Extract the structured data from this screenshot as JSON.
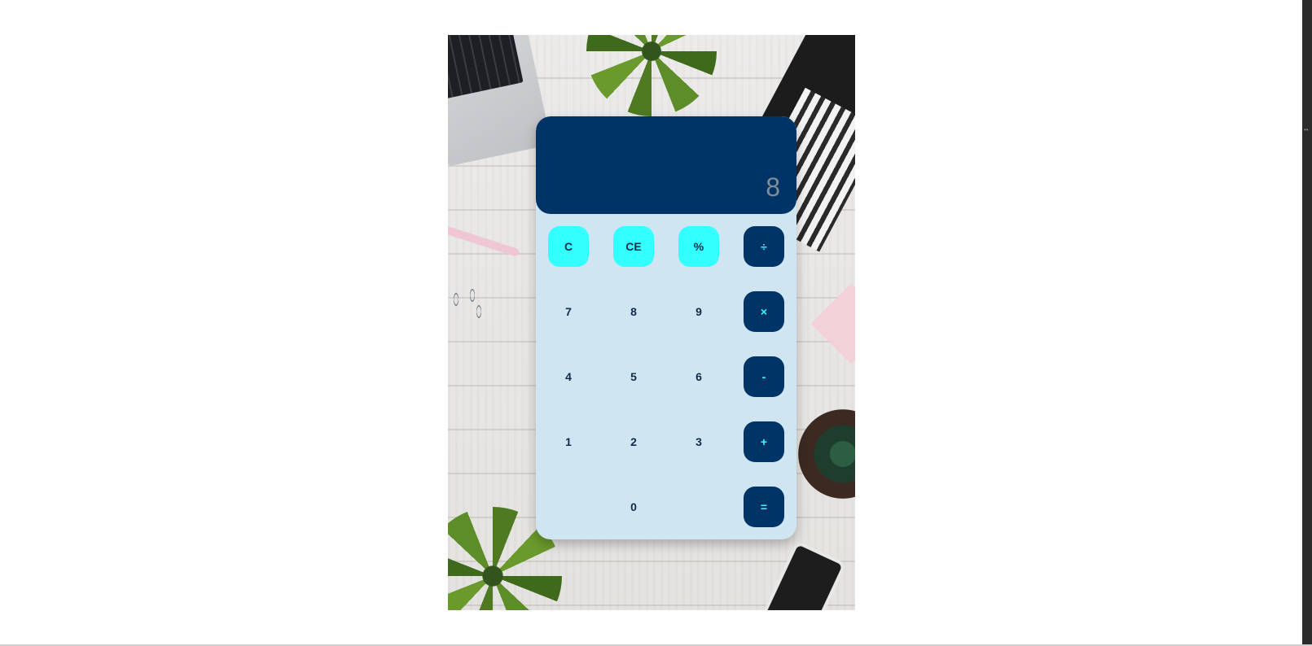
{
  "calculator": {
    "display": "8",
    "keys": {
      "clear": "C",
      "clear_entry": "CE",
      "percent": "%",
      "divide": "÷",
      "seven": "7",
      "eight": "8",
      "nine": "9",
      "multiply": "×",
      "four": "4",
      "five": "5",
      "six": "6",
      "subtract": "-",
      "one": "1",
      "two": "2",
      "three": "3",
      "add": "+",
      "zero": "0",
      "equals": "="
    }
  },
  "colors": {
    "display_bg": "#003366",
    "body_bg": "#cfe6f2",
    "function_key_bg": "#33ffff",
    "operator_key_bg": "#003366",
    "operator_key_text": "#33ffff"
  }
}
